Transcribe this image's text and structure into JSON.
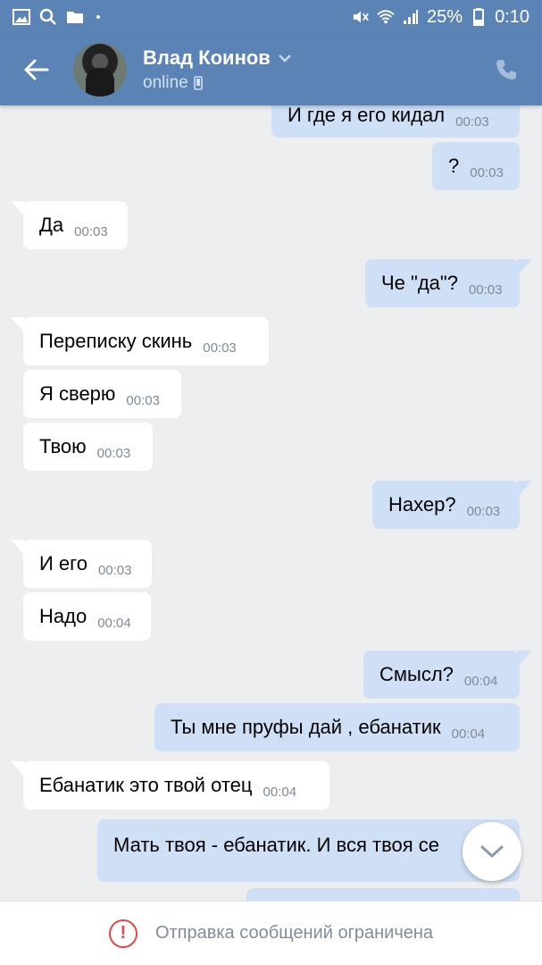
{
  "statusbar": {
    "icons_left": [
      "gallery-icon",
      "search-icon",
      "folder-icon",
      "dot-icon"
    ],
    "battery": "25%",
    "time": "0:10"
  },
  "header": {
    "name": "Влад Коинов",
    "status": "online"
  },
  "messages": [
    {
      "dir": "out",
      "text": "И где я его кидал",
      "time": "00:03"
    },
    {
      "dir": "out",
      "text": "?",
      "time": "00:03"
    },
    {
      "dir": "in",
      "text": "Да",
      "time": "00:03"
    },
    {
      "dir": "out",
      "text": "Че \"да\"?",
      "time": "00:03"
    },
    {
      "dir": "in",
      "text": "Переписку скинь",
      "time": "00:03"
    },
    {
      "dir": "in",
      "text": "Я сверю",
      "time": "00:03"
    },
    {
      "dir": "in",
      "text": "Твою",
      "time": "00:03"
    },
    {
      "dir": "out",
      "text": "Нахер?",
      "time": "00:03"
    },
    {
      "dir": "in",
      "text": "И его",
      "time": "00:03"
    },
    {
      "dir": "in",
      "text": "Надо",
      "time": "00:04"
    },
    {
      "dir": "out",
      "text": "Смысл?",
      "time": "00:04"
    },
    {
      "dir": "out",
      "text": "Ты мне пруфы дай , ебанатик",
      "time": "00:04"
    },
    {
      "dir": "in",
      "text": "Ебанатик это твой отец",
      "time": "00:04"
    },
    {
      "dir": "out",
      "text": "Мать твоя - ебанатик. И вся твоя се",
      "time": ""
    },
    {
      "dir": "out",
      "text": "",
      "time": ""
    }
  ],
  "bottom": {
    "text": "Отправка сообщений ограничена"
  },
  "colors": {
    "header": "#5b83b5",
    "incoming": "#ffffff",
    "outgoing": "#cfdff5",
    "warning": "#e64646"
  }
}
